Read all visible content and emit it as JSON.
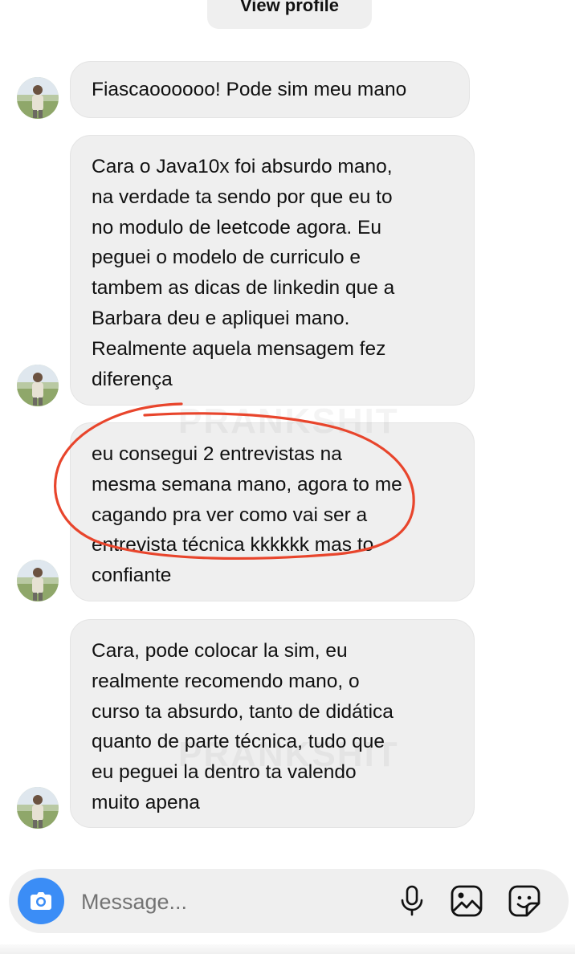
{
  "header": {
    "view_profile_label": "View profile"
  },
  "watermark": "PRANKSHIT",
  "messages": [
    {
      "text": "Fiascaoooooo! Pode sim meu mano"
    },
    {
      "text": "Cara o Java10x foi absurdo mano,\nna verdade ta sendo por que eu to\nno modulo de leetcode agora. Eu\npeguei o modelo de curriculo e\ntambem as dicas de linkedin que a\nBarbara deu e apliquei mano.\nRealmente aquela mensagem fez\ndiferença"
    },
    {
      "text": "eu consegui 2 entrevistas na\nmesma semana mano, agora to me\ncagando pra ver como vai ser a\nentrevista técnica kkkkkk mas to\nconfiante"
    },
    {
      "text": "Cara, pode colocar la sim, eu\nrealmente recomendo mano, o\ncurso ta absurdo, tanto de didática\nquanto de parte técnica, tudo que\neu peguei la dentro ta valendo\nmuito apena"
    }
  ],
  "composer": {
    "placeholder": "Message...",
    "camera_icon": "camera-icon",
    "mic_icon": "microphone-icon",
    "image_icon": "image-icon",
    "sticker_icon": "sticker-icon"
  },
  "colors": {
    "bubble_bg": "#efefef",
    "camera_button": "#3b8df6",
    "annotation": "#e8452c"
  }
}
